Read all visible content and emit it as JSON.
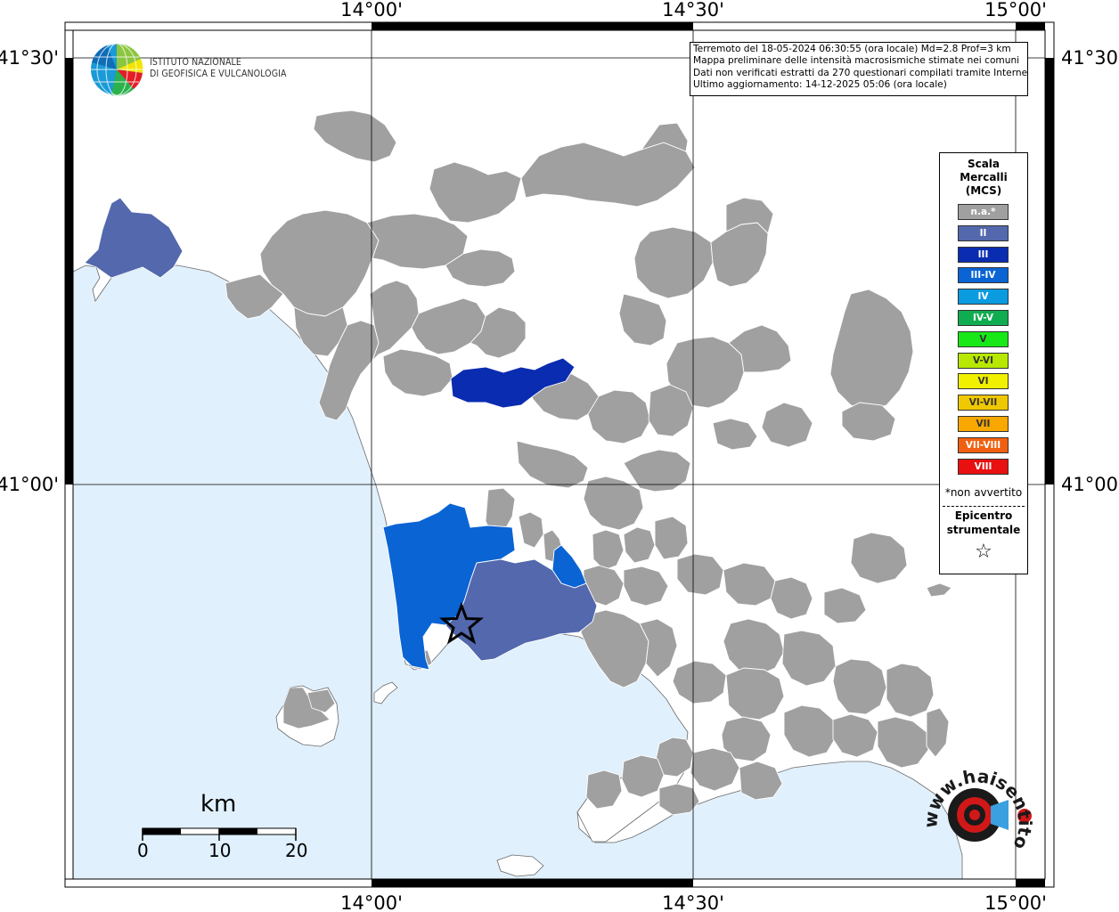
{
  "map": {
    "title_lines": [
      "Terremoto del 18-05-2024 06:30:55 (ora locale) Md=2.8 Prof=3 km",
      "Mappa preliminare delle intensità macrosismiche stimate nei comuni",
      "Dati non verificati estratti da 270 questionari compilati tramite Internet.",
      "Ultimo aggiornamento: 14-12-2025 05:06 (ora locale)"
    ],
    "lon_labels": [
      "14°00'",
      "14°30'",
      "15°00'"
    ],
    "lat_labels": [
      "41°30'",
      "41°00'"
    ],
    "institute": "ISTITUTO NAZIONALE\nDI GEOFISICA E VULCANOLOGIA",
    "scale_bar": {
      "unit": "km",
      "ticks": [
        "0",
        "10",
        "20"
      ]
    },
    "watermark": "www.haisentitoilterremoto.it"
  },
  "legend": {
    "title": "Scala\nMercalli\n(MCS)",
    "items": [
      {
        "label": "n.a.*",
        "color": "#a0a0a0"
      },
      {
        "label": "II",
        "color": "#5368ad"
      },
      {
        "label": "III",
        "color": "#0a2cb0"
      },
      {
        "label": "III-IV",
        "color": "#0a64d4"
      },
      {
        "label": "IV",
        "color": "#0a9be0"
      },
      {
        "label": "IV-V",
        "color": "#10ad50"
      },
      {
        "label": "V",
        "color": "#18e818"
      },
      {
        "label": "V-VI",
        "color": "#b8e800"
      },
      {
        "label": "VI",
        "color": "#f0f000"
      },
      {
        "label": "VI-VII",
        "color": "#f0c800"
      },
      {
        "label": "VII",
        "color": "#f8a800"
      },
      {
        "label": "VII-VIII",
        "color": "#f06010"
      },
      {
        "label": "VIII",
        "color": "#e81010"
      }
    ],
    "note": "*non avvertito",
    "epicenter_label": "Epicentro\nstrumentale",
    "star": "☆"
  },
  "colors": {
    "sea": "#e0f0fc",
    "land": "#ffffff",
    "municipality_na": "#a0a0a0",
    "intensity_II": "#5368ad",
    "intensity_III": "#0a2cb0",
    "intensity_III_IV": "#0a64d4"
  }
}
